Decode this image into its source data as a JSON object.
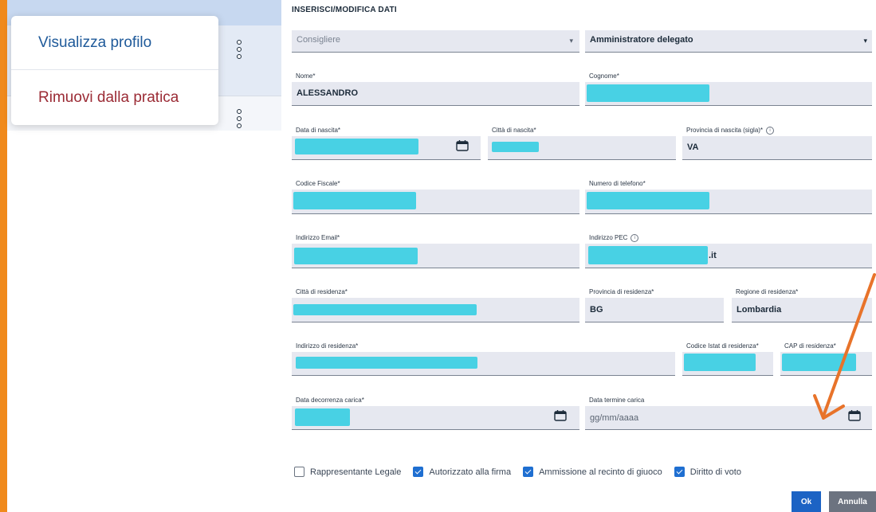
{
  "left_panel": {
    "popup_items": [
      "Visualizza profilo",
      "Rimuovi dalla pratica"
    ]
  },
  "form": {
    "title": "INSERISCI/MODIFICA DATI",
    "role_select": {
      "value": "Consigliere"
    },
    "position_select": {
      "value": "Amministratore delegato"
    },
    "fields": {
      "nome": {
        "label": "Nome*",
        "value": "ALESSANDRO"
      },
      "cognome": {
        "label": "Cognome*",
        "value": ""
      },
      "data_nascita": {
        "label": "Data di nascita*",
        "value": ""
      },
      "citta_nascita": {
        "label": "Città di nascita*",
        "value": ""
      },
      "provincia_nascita": {
        "label": "Provincia di nascita (sigla)*",
        "value": "VA"
      },
      "codice_fiscale": {
        "label": "Codice Fiscale*",
        "value": ""
      },
      "telefono": {
        "label": "Numero di telefono*",
        "value": ""
      },
      "email": {
        "label": "Indirizzo Email*",
        "value": ""
      },
      "pec": {
        "label": "Indirizzo PEC",
        "value_suffix": ".it"
      },
      "citta_residenza": {
        "label": "Città di residenza*",
        "value": ""
      },
      "provincia_residenza": {
        "label": "Provincia di residenza*",
        "value": "BG"
      },
      "regione_residenza": {
        "label": "Regione di residenza*",
        "value": "Lombardia"
      },
      "indirizzo_residenza": {
        "label": "Indirizzo di residenza*",
        "value": ""
      },
      "codice_istat": {
        "label": "Codice Istat di residenza*",
        "value": ""
      },
      "cap": {
        "label": "CAP di residenza*",
        "value": ""
      },
      "data_decorrenza": {
        "label": "Data decorrenza carica*",
        "value": ""
      },
      "data_termine": {
        "label": "Data termine carica",
        "placeholder": "gg/mm/aaaa"
      }
    },
    "checkboxes": [
      {
        "label": "Rappresentante Legale",
        "checked": false
      },
      {
        "label": "Autorizzato alla firma",
        "checked": true
      },
      {
        "label": "Ammissione al recinto di giuoco",
        "checked": true
      },
      {
        "label": "Diritto di voto",
        "checked": true
      }
    ],
    "buttons": {
      "ok": "Ok",
      "cancel": "Annulla"
    }
  },
  "colors": {
    "accent": "#1c63c4",
    "annotation_arrow": "#e8732a",
    "redaction": "#3fd0e3"
  }
}
